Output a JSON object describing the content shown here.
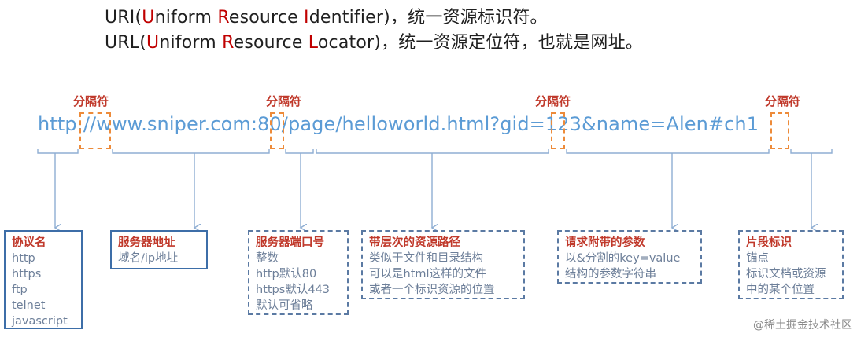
{
  "header": {
    "uri": {
      "pre": "URI(",
      "u1": "U",
      "t1": "niform ",
      "u2": "R",
      "t2": "esource ",
      "u3": "I",
      "t3": "dentifier)，统一资源标识符。"
    },
    "url": {
      "pre": "URL(",
      "u1": "U",
      "t1": "niform ",
      "u2": "R",
      "t2": "esource ",
      "u3": "L",
      "t3": "ocator)，统一资源定位符，也就是网址。"
    }
  },
  "example_url": "http://www.sniper.com:80/page/helloworld.html?gid=123&name=Alen#ch1",
  "separator_label": "分隔符",
  "boxes": [
    {
      "title": "协议名",
      "items": [
        "http",
        "https",
        "ftp",
        "telnet",
        "javascript"
      ]
    },
    {
      "title": "服务器地址",
      "items": [
        "域名/ip地址"
      ]
    },
    {
      "title": "服务器端口号",
      "items": [
        "整数",
        "http默认80",
        "https默认443",
        "默认可省略"
      ]
    },
    {
      "title": "带层次的资源路径",
      "items": [
        "类似于文件和目录结构",
        "可以是html这样的文件",
        "或者一个标识资源的位置"
      ]
    },
    {
      "title": "请求附带的参数",
      "items": [
        "以&分割的key=value",
        "结构的参数字符串"
      ]
    },
    {
      "title": "片段标识",
      "items": [
        "锚点",
        "标识文档或资源",
        "中的某个位置"
      ]
    }
  ],
  "watermark": "@稀土掘金技术社区",
  "colors": {
    "accent_red": "#c00000",
    "url_blue": "#5b9bd5",
    "separator_orange": "#ed8b3a",
    "box_border": "#3d6ea8"
  }
}
